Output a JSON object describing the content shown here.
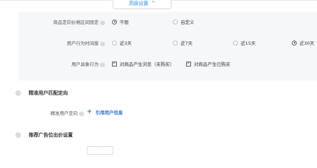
{
  "tab": {
    "label": "高级设置",
    "caret": "^"
  },
  "price_range": {
    "label": "商品定向价格区间限定",
    "options": [
      "不限",
      "自定义"
    ],
    "selected": "不限"
  },
  "behavior_time": {
    "label": "用户行为时间窗",
    "options": [
      "近3天",
      "近7天",
      "近15天",
      "近30天"
    ],
    "selected": "近30天"
  },
  "user_behavior": {
    "label": "用户具象行为",
    "options": [
      "对商品产生浏览（未购买）",
      "对商品产生已购买"
    ]
  },
  "precise_section": {
    "title": "精准用户匹配定向",
    "field_label": "精准用户定向",
    "link_label": "引用用户信息"
  },
  "bid_section": {
    "title": "推荐广告位出价设置"
  },
  "help_glyph": "?"
}
